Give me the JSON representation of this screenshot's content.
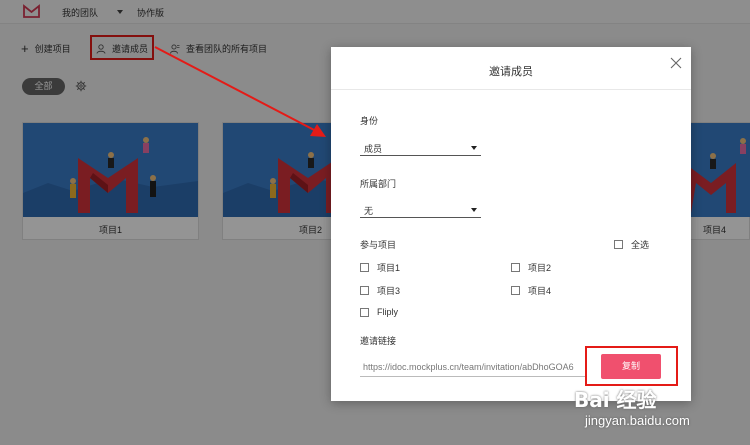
{
  "topbar": {
    "team_name": "我的团队",
    "collab_label": "协作版"
  },
  "toolbar": {
    "create_label": "创建项目",
    "invite_label": "邀请成员",
    "view_all_label": "查看团队的所有项目"
  },
  "filter": {
    "all_label": "全部"
  },
  "projects": [
    {
      "name": "项目1"
    },
    {
      "name": "项目2"
    },
    {
      "name": "项目4"
    }
  ],
  "modal": {
    "title": "邀请成员",
    "role_label": "身份",
    "role_value": "成员",
    "dept_label": "所属部门",
    "dept_value": "无",
    "projects_label": "参与项目",
    "select_all_label": "全选",
    "project_options": [
      "项目1",
      "项目2",
      "项目3",
      "项目4",
      "Fliply"
    ],
    "link_label": "邀请链接",
    "link_value": "https://idoc.mockplus.cn/team/invitation/abDhoGOA6",
    "copy_label": "复制"
  },
  "watermark": {
    "brand": "Bai 经验",
    "url": "jingyan.baidu.com"
  },
  "colors": {
    "accent": "#f0506e",
    "annotation_red": "#e41b17",
    "thumb_blue": "#3a7cc8",
    "logo_red": "#d23a55"
  },
  "icons": [
    "logo-icon",
    "plus-icon",
    "person-icon",
    "team-person-icon",
    "gear-icon",
    "close-icon",
    "chevron-down-icon"
  ]
}
